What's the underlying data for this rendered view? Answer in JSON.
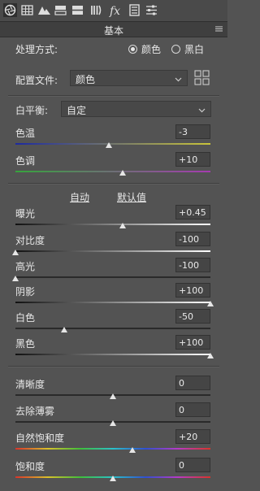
{
  "panel": {
    "title": "基本"
  },
  "toolbar": {
    "icons": [
      "aperture-icon",
      "grid-icon",
      "mountains-icon",
      "split-toning-icon",
      "hsl-icon",
      "detail-icon",
      "fx-icon",
      "camera-calibration-icon",
      "presets-icon"
    ]
  },
  "treatment": {
    "label": "处理方式:",
    "options": [
      {
        "label": "颜色",
        "selected": true
      },
      {
        "label": "黑白",
        "selected": false
      }
    ]
  },
  "profile": {
    "label": "配置文件:",
    "value": "颜色"
  },
  "white_balance": {
    "label": "白平衡:",
    "value": "自定"
  },
  "links": {
    "auto": "自动",
    "default": "默认值"
  },
  "sliders": [
    {
      "id": "temp",
      "label": "色温",
      "value": "-3",
      "position": 0.48,
      "colors": [
        "#1d2aa0",
        "#c9c43a"
      ]
    },
    {
      "id": "tint",
      "label": "色调",
      "value": "+10",
      "position": 0.55,
      "colors": [
        "#36a43c",
        "#a53bb0"
      ]
    },
    {
      "id": "exposure",
      "label": "曝光",
      "value": "+0.45",
      "position": 0.55,
      "colors": [
        "#111111",
        "#ffffff"
      ]
    },
    {
      "id": "contrast",
      "label": "对比度",
      "value": "-100",
      "position": 0.0,
      "colors": [
        "#111111",
        "#ffffff"
      ]
    },
    {
      "id": "highlights",
      "label": "高光",
      "value": "-100",
      "position": 0.0,
      "colors": [
        "#2a2a2a",
        "#2a2a2a"
      ]
    },
    {
      "id": "shadows",
      "label": "阴影",
      "value": "+100",
      "position": 1.0,
      "colors": [
        "#111111",
        "#ffffff"
      ]
    },
    {
      "id": "whites",
      "label": "白色",
      "value": "-50",
      "position": 0.25,
      "colors": [
        "#2a2a2a",
        "#2a2a2a"
      ]
    },
    {
      "id": "blacks",
      "label": "黑色",
      "value": "+100",
      "position": 1.0,
      "colors": [
        "#111111",
        "#ffffff"
      ]
    },
    {
      "id": "clarity",
      "label": "清晰度",
      "value": "0",
      "position": 0.5,
      "colors": [
        "#2a2a2a",
        "#2a2a2a"
      ]
    },
    {
      "id": "dehaze",
      "label": "去除薄雾",
      "value": "0",
      "position": 0.5,
      "colors": [
        "#2a2a2a",
        "#2a2a2a"
      ]
    },
    {
      "id": "vibrance",
      "label": "自然饱和度",
      "value": "+20",
      "position": 0.6,
      "colors": [
        "rainbow"
      ]
    },
    {
      "id": "saturation",
      "label": "饱和度",
      "value": "0",
      "position": 0.5,
      "colors": [
        "rainbow"
      ]
    }
  ]
}
